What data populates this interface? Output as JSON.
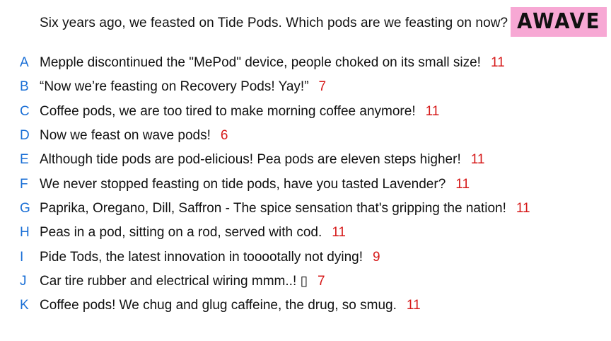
{
  "question": "Six years ago, we feasted on Tide Pods. Which pods are we feasting on now?",
  "logo": "AWAVE",
  "colors": {
    "letter": "#1a6fd6",
    "score": "#d61a1a",
    "logo_bg": "#f7a8d4"
  },
  "answers": [
    {
      "letter": "A",
      "text": "Mepple discontinued the \"MePod\" device, people choked on its small size!",
      "score": "11"
    },
    {
      "letter": "B",
      "text": "“Now we’re feasting on Recovery Pods! Yay!”",
      "score": "7"
    },
    {
      "letter": "C",
      "text": "Coffee pods, we are too tired to make morning coffee anymore!",
      "score": "11"
    },
    {
      "letter": "D",
      "text": "Now we feast on wave pods!",
      "score": "6"
    },
    {
      "letter": "E",
      "text": "Although tide pods are pod-elicious! Pea pods are eleven steps higher!",
      "score": "11"
    },
    {
      "letter": "F",
      "text": "We never stopped feasting on tide pods, have you tasted Lavender?",
      "score": "11"
    },
    {
      "letter": "G",
      "text": "Paprika, Oregano, Dill, Saffron - The spice sensation that's gripping the nation!",
      "score": "11"
    },
    {
      "letter": "H",
      "text": "Peas in a pod, sitting on a rod, served with cod.",
      "score": "11"
    },
    {
      "letter": "I",
      "text": "Pide Tods, the latest innovation in tooootally not dying!",
      "score": "9"
    },
    {
      "letter": "J",
      "text": "Car tire rubber and electrical wiring mmm..! ▯",
      "score": "7"
    },
    {
      "letter": "K",
      "text": "Coffee pods! We chug and glug caffeine, the drug, so smug.",
      "score": "11"
    }
  ]
}
